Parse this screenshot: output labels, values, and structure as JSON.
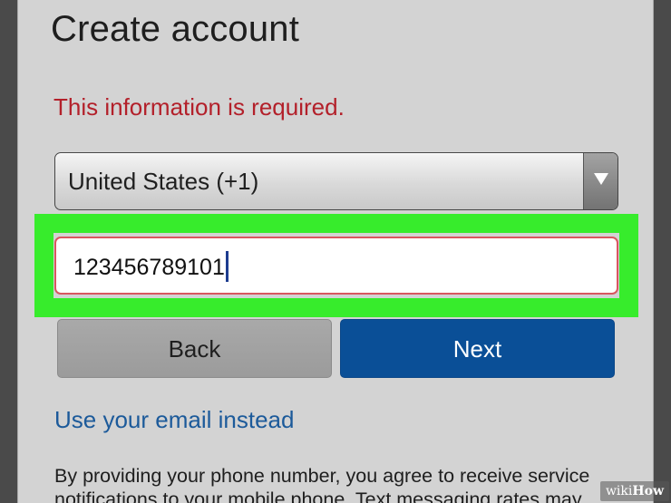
{
  "form": {
    "title": "Create account",
    "error_message": "This information is required.",
    "country_select": {
      "selected": "United States (+1)"
    },
    "phone_input": {
      "value": "123456789101"
    },
    "buttons": {
      "back_label": "Back",
      "next_label": "Next"
    },
    "email_link": "Use your email instead",
    "disclaimer": "By providing your phone number, you agree to receive service notifications to your mobile phone. Text messaging rates may"
  },
  "watermark": {
    "part1": "wiki",
    "part2": "How"
  },
  "colors": {
    "background": "#d3d3d3",
    "error_red": "#b3202a",
    "highlight_green": "#37ec2c",
    "next_button_blue": "#0a4f97",
    "back_button_gray": "#a3a3a3",
    "link_blue": "#1c5a9a",
    "input_border_red": "#d9565f"
  },
  "icons": {
    "select_arrow": "chevron-down-icon"
  }
}
